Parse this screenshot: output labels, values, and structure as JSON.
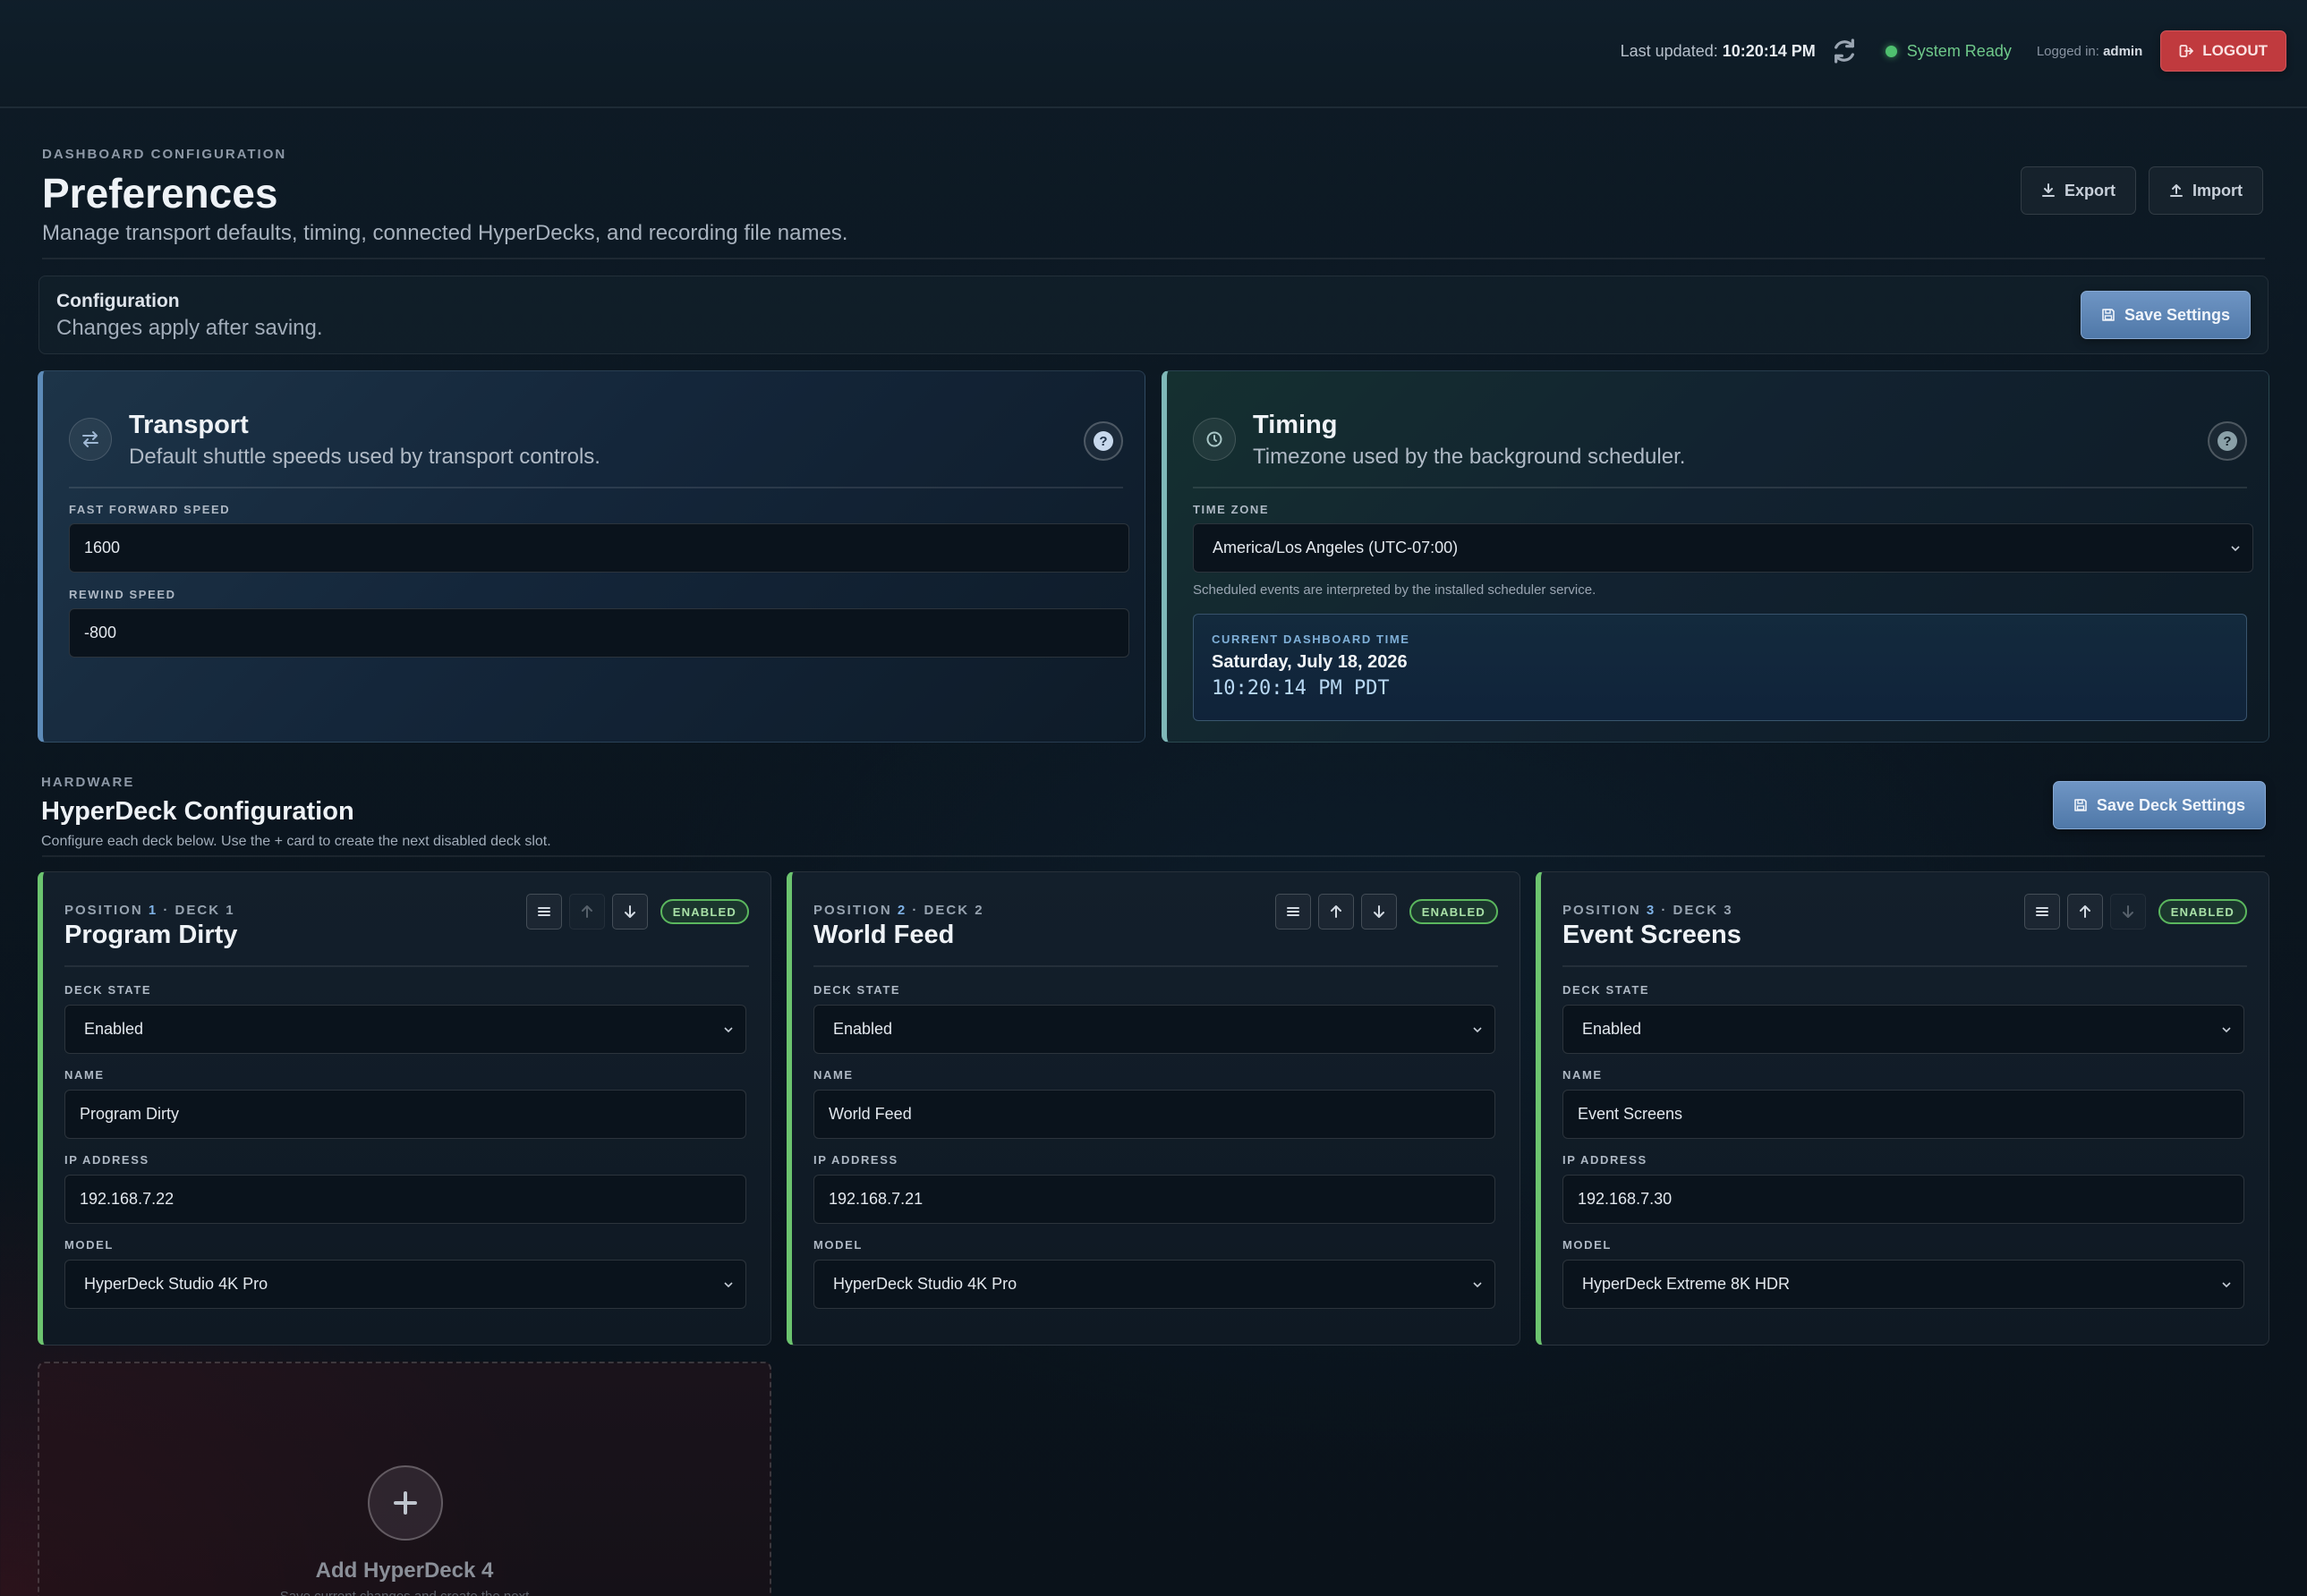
{
  "topbar": {
    "last_updated_label": "Last updated:",
    "last_updated_time": "10:20:14 PM",
    "status": "System Ready",
    "logged_in_label": "Logged in:",
    "user": "admin",
    "logout": "LOGOUT"
  },
  "header": {
    "kicker": "DASHBOARD CONFIGURATION",
    "title": "Preferences",
    "description": "Manage transport defaults, timing, connected HyperDecks, and recording file names.",
    "export": "Export",
    "import": "Import"
  },
  "config": {
    "title": "Configuration",
    "description": "Changes apply after saving.",
    "save": "Save Settings"
  },
  "transport": {
    "title": "Transport",
    "description": "Default shuttle speeds used by transport controls.",
    "ff_label": "FAST FORWARD SPEED",
    "ff_value": "1600",
    "rw_label": "REWIND SPEED",
    "rw_value": "-800"
  },
  "timing": {
    "title": "Timing",
    "description": "Timezone used by the background scheduler.",
    "tz_label": "TIME ZONE",
    "tz_value": "America/Los Angeles (UTC-07:00)",
    "hint": "Scheduled events are interpreted by the installed scheduler service.",
    "current_label": "CURRENT DASHBOARD TIME",
    "date": "Saturday, July 18, 2026",
    "clock": "10:20:14 PM PDT"
  },
  "hardware": {
    "kicker": "HARDWARE",
    "title": "HyperDeck Configuration",
    "description": "Configure each deck below. Use the + card to create the next disabled deck slot.",
    "save": "Save Deck Settings"
  },
  "deck_labels": {
    "position": "POSITION",
    "deck": "· DECK",
    "state": "DECK STATE",
    "name": "NAME",
    "ip": "IP ADDRESS",
    "model": "MODEL"
  },
  "decks": [
    {
      "position": "1",
      "deck": "1",
      "title": "Program Dirty",
      "badge": "ENABLED",
      "state": "Enabled",
      "name": "Program Dirty",
      "ip": "192.168.7.22",
      "model": "HyperDeck Studio 4K Pro"
    },
    {
      "position": "2",
      "deck": "2",
      "title": "World Feed",
      "badge": "ENABLED",
      "state": "Enabled",
      "name": "World Feed",
      "ip": "192.168.7.21",
      "model": "HyperDeck Studio 4K Pro"
    },
    {
      "position": "3",
      "deck": "3",
      "title": "Event Screens",
      "badge": "ENABLED",
      "state": "Enabled",
      "name": "Event Screens",
      "ip": "192.168.7.30",
      "model": "HyperDeck Extreme 8K HDR"
    }
  ],
  "add_card": {
    "title": "Add HyperDeck 4",
    "description": "Save current changes and create the next"
  }
}
